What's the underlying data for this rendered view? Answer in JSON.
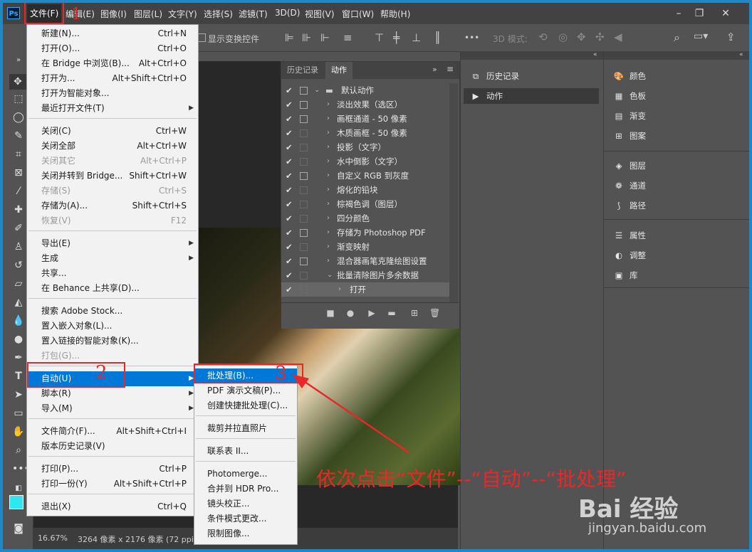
{
  "menubar": {
    "logo": "Ps",
    "items": [
      "文件(F)",
      "编辑(E)",
      "图像(I)",
      "图层(L)",
      "文字(Y)",
      "选择(S)",
      "滤镜(T)",
      "3D(D)",
      "视图(V)",
      "窗口(W)",
      "帮助(H)"
    ],
    "window_buttons": [
      "–",
      "❐",
      "✕"
    ]
  },
  "optionbar": {
    "show_transform": "显示变换控件",
    "mode_3d": "3D 模式:",
    "more": "•••"
  },
  "file_menu": {
    "items": [
      {
        "label": "新建(N)...",
        "shortcut": "Ctrl+N"
      },
      {
        "label": "打开(O)...",
        "shortcut": "Ctrl+O"
      },
      {
        "label": "在 Bridge 中浏览(B)...",
        "shortcut": "Alt+Ctrl+O"
      },
      {
        "label": "打开为...",
        "shortcut": "Alt+Shift+Ctrl+O"
      },
      {
        "label": "打开为智能对象...",
        "shortcut": ""
      },
      {
        "label": "最近打开文件(T)",
        "shortcut": ""
      },
      {
        "label": "关闭(C)",
        "shortcut": "Ctrl+W"
      },
      {
        "label": "关闭全部",
        "shortcut": "Alt+Ctrl+W"
      },
      {
        "label": "关闭其它",
        "shortcut": "Alt+Ctrl+P"
      },
      {
        "label": "关闭并转到 Bridge...",
        "shortcut": "Shift+Ctrl+W"
      },
      {
        "label": "存储(S)",
        "shortcut": "Ctrl+S"
      },
      {
        "label": "存储为(A)...",
        "shortcut": "Shift+Ctrl+S"
      },
      {
        "label": "恢复(V)",
        "shortcut": "F12"
      },
      {
        "label": "导出(E)",
        "shortcut": ""
      },
      {
        "label": "生成",
        "shortcut": ""
      },
      {
        "label": "共享...",
        "shortcut": ""
      },
      {
        "label": "在 Behance 上共享(D)...",
        "shortcut": ""
      },
      {
        "label": "搜索 Adobe Stock...",
        "shortcut": ""
      },
      {
        "label": "置入嵌入对象(L)...",
        "shortcut": ""
      },
      {
        "label": "置入链接的智能对象(K)...",
        "shortcut": ""
      },
      {
        "label": "打包(G)...",
        "shortcut": ""
      },
      {
        "label": "自动(U)",
        "shortcut": ""
      },
      {
        "label": "脚本(R)",
        "shortcut": ""
      },
      {
        "label": "导入(M)",
        "shortcut": ""
      },
      {
        "label": "文件简介(F)...",
        "shortcut": "Alt+Shift+Ctrl+I"
      },
      {
        "label": "版本历史记录(V)",
        "shortcut": ""
      },
      {
        "label": "打印(P)...",
        "shortcut": "Ctrl+P"
      },
      {
        "label": "打印一份(Y)",
        "shortcut": "Alt+Shift+Ctrl+P"
      },
      {
        "label": "退出(X)",
        "shortcut": "Ctrl+Q"
      }
    ]
  },
  "auto_submenu": {
    "items": [
      "批处理(B)...",
      "PDF 演示文稿(P)...",
      "创建快捷批处理(C)...",
      "裁剪并拉直照片",
      "联系表 II...",
      "Photomerge...",
      "合并到 HDR Pro...",
      "镜头校正...",
      "条件模式更改...",
      "限制图像..."
    ]
  },
  "actions_panel": {
    "tabs": [
      "历史记录",
      "动作"
    ],
    "rows": [
      "默认动作",
      "淡出效果（选区）",
      "画框通道 - 50 像素",
      "木质画框 - 50 像素",
      "投影（文字）",
      "水中倒影（文字）",
      "自定义 RGB 到灰度",
      "熔化的铅块",
      "棕褐色调（图层）",
      "四分颜色",
      "存储为 Photoshop PDF",
      "渐变映射",
      "混合器画笔克隆绘图设置",
      "批量清除图片多余数据",
      "打开"
    ]
  },
  "dock1": {
    "items": [
      "历史记录",
      "动作"
    ]
  },
  "dock2": {
    "groups": [
      [
        "颜色",
        "色板",
        "渐变",
        "图案"
      ],
      [
        "图层",
        "通道",
        "路径"
      ],
      [
        "属性",
        "调整",
        "库"
      ]
    ]
  },
  "status": {
    "zoom": "16.67%",
    "info": "3264 像素 x 2176 像素 (72 ppi)"
  },
  "annotations": {
    "n1": "1",
    "n2": "2",
    "n3": "3",
    "caption": "依次点击“文件”--“自动”--“批处理”",
    "color": "#e8272a"
  },
  "watermark": {
    "brand": "Bai 经验",
    "url": "jingyan.baidu.com"
  }
}
